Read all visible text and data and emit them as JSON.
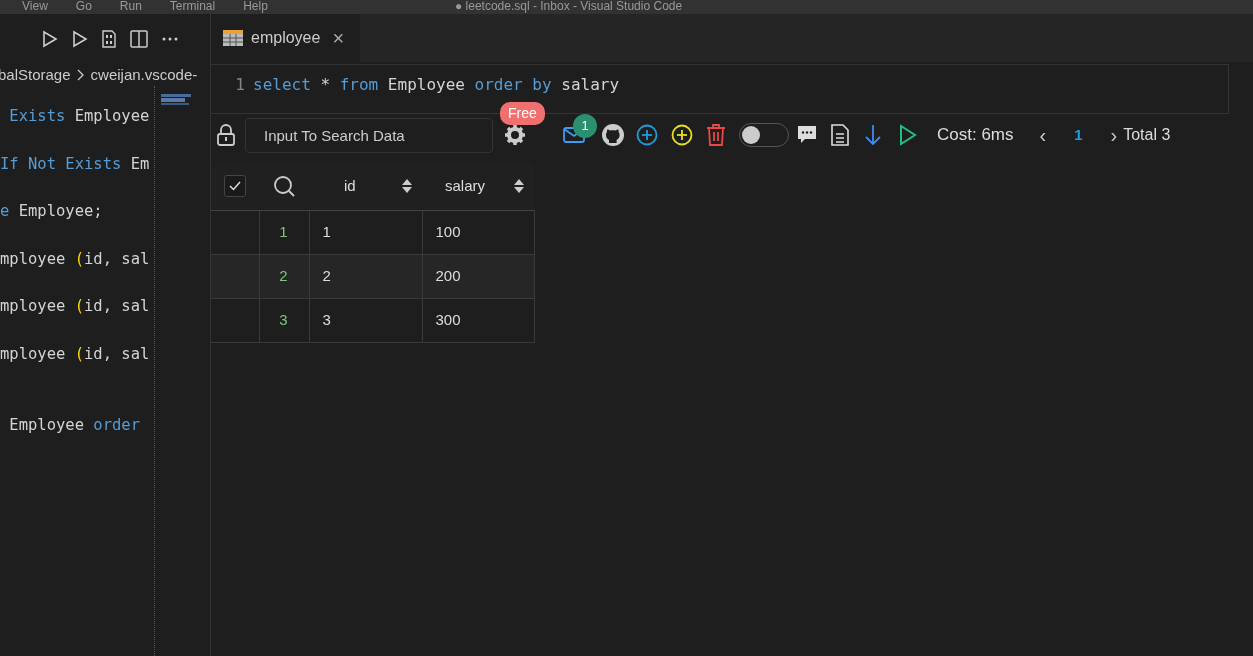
{
  "title_bar": {
    "menu": [
      "View",
      "Go",
      "Run",
      "Terminal",
      "Help"
    ],
    "title": "● leetcode.sql - Inbox - Visual Studio Code"
  },
  "left_editor": {
    "breadcrumb": [
      "balStorage",
      "cweijan.vscode-"
    ],
    "lines": [
      {
        "tokens": [
          {
            "text": " Exists",
            "kind": "keyword"
          },
          {
            "text": " Employee",
            "kind": "plain"
          }
        ]
      },
      {
        "tokens": [
          {
            "text": "If Not Exists",
            "kind": "keyword"
          },
          {
            "text": " Em",
            "kind": "plain"
          }
        ]
      },
      {
        "tokens": [
          {
            "text": "e",
            "kind": "keyword"
          },
          {
            "text": " Employee;",
            "kind": "plain"
          }
        ]
      },
      {
        "tokens": [
          {
            "text": "mployee ",
            "kind": "plain"
          },
          {
            "text": "(",
            "kind": "paren"
          },
          {
            "text": "id, sal",
            "kind": "plain"
          }
        ]
      },
      {
        "tokens": [
          {
            "text": "mployee ",
            "kind": "plain"
          },
          {
            "text": "(",
            "kind": "paren"
          },
          {
            "text": "id, sal",
            "kind": "plain"
          }
        ]
      },
      {
        "tokens": [
          {
            "text": "mployee ",
            "kind": "plain"
          },
          {
            "text": "(",
            "kind": "paren"
          },
          {
            "text": "id, sal",
            "kind": "plain"
          }
        ]
      },
      {
        "tokens": [
          {
            "text": " Employee",
            "kind": "plain"
          },
          {
            "text": " order",
            "kind": "keyword"
          }
        ],
        "blank_before": true
      }
    ]
  },
  "tab": {
    "label": "employee",
    "close": "×"
  },
  "query": {
    "line_number": "1",
    "tokens": [
      {
        "text": "select",
        "kind": "keyword"
      },
      {
        "text": " * ",
        "kind": "plain"
      },
      {
        "text": "from",
        "kind": "keyword"
      },
      {
        "text": " Employee ",
        "kind": "plain"
      },
      {
        "text": "order by",
        "kind": "keyword"
      },
      {
        "text": " salary",
        "kind": "plain"
      }
    ]
  },
  "toolbar": {
    "search": {
      "placeholder": "Input To Search Data"
    },
    "free_badge": "Free",
    "mail_count": "1",
    "toggle_on": false,
    "cost": "Cost: 6ms",
    "prev": "‹",
    "page": "1",
    "next": "›",
    "total": "Total 3"
  },
  "table": {
    "select_all_checked": true,
    "columns": [
      "id",
      "salary"
    ],
    "rows": [
      {
        "index": "1",
        "cells": [
          "1",
          "100"
        ]
      },
      {
        "index": "2",
        "cells": [
          "2",
          "200"
        ]
      },
      {
        "index": "3",
        "cells": [
          "3",
          "300"
        ]
      }
    ]
  }
}
